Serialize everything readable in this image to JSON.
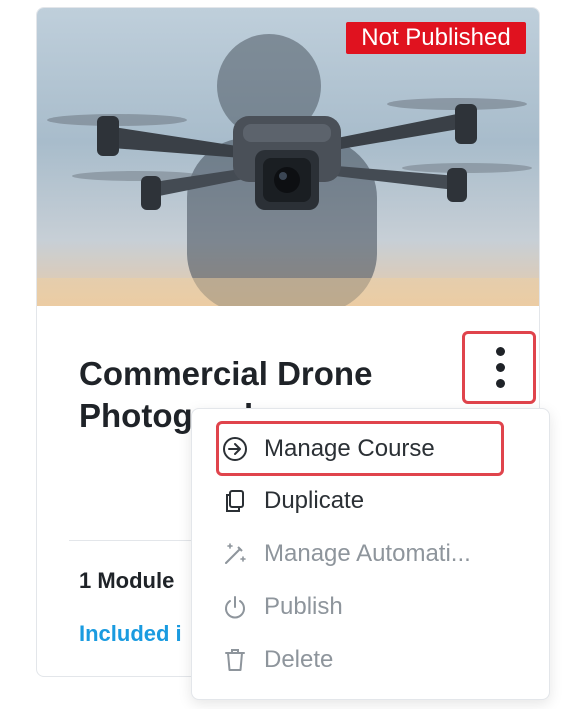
{
  "card": {
    "status_badge": "Not Published",
    "title": "Commercial Drone Photography",
    "modules": "1 Module",
    "pricing": "Included i",
    "image_alt": "drone"
  },
  "menu": {
    "items": [
      {
        "label": "Manage Course",
        "icon": "arrow-circle-right-icon",
        "enabled": true,
        "highlighted": true
      },
      {
        "label": "Duplicate",
        "icon": "copy-icon",
        "enabled": true
      },
      {
        "label": "Manage Automati...",
        "icon": "magic-wand-icon",
        "enabled": false
      },
      {
        "label": "Publish",
        "icon": "power-icon",
        "enabled": false
      },
      {
        "label": "Delete",
        "icon": "trash-icon",
        "enabled": false
      }
    ]
  },
  "colors": {
    "badge": "#e0121f",
    "highlight": "#e0444c",
    "link": "#1a9be0",
    "text": "#1f2328"
  }
}
